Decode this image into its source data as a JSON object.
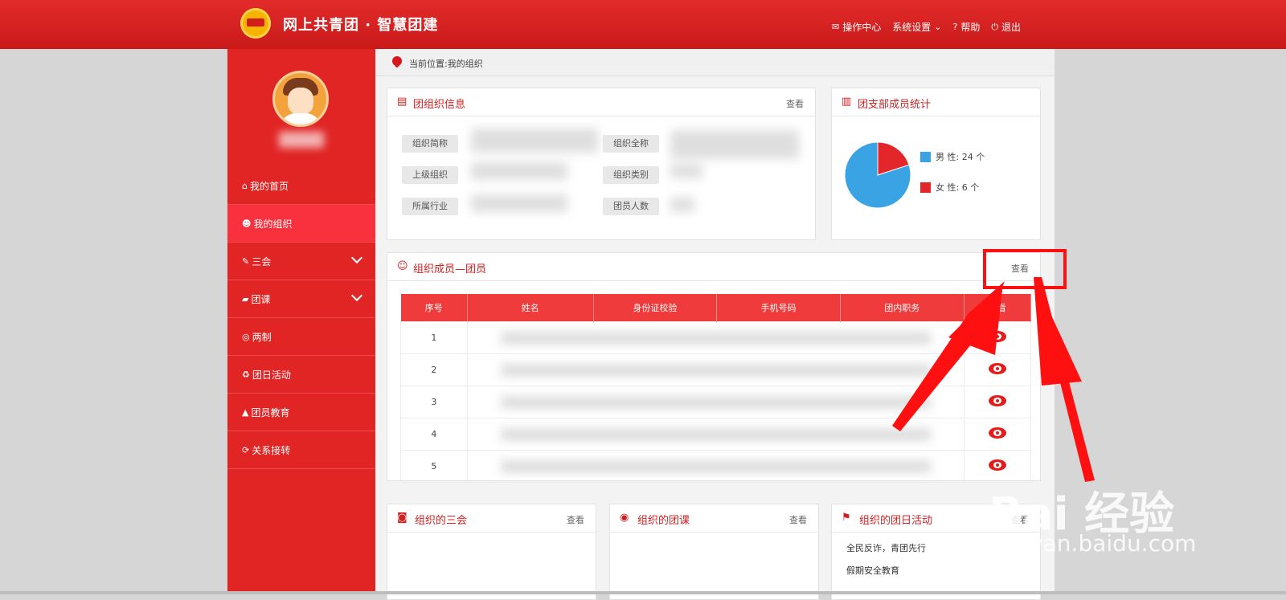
{
  "header": {
    "brand": "网上共青团 · 智慧团建",
    "nav": [
      {
        "icon": "mail-icon",
        "label": "操作中心"
      },
      {
        "icon": "chevron-down-icon",
        "label": "系统设置"
      },
      {
        "icon": "help-icon",
        "label": "帮助"
      },
      {
        "icon": "power-icon",
        "label": "退出"
      }
    ]
  },
  "sidebar": {
    "items": [
      {
        "icon": "home-icon",
        "label": "我的首页"
      },
      {
        "icon": "users-icon",
        "label": "我的组织"
      },
      {
        "icon": "edit-icon",
        "label": "三会"
      },
      {
        "icon": "folder-icon",
        "label": "团课"
      },
      {
        "icon": "target-icon",
        "label": "两制"
      },
      {
        "icon": "recycle-icon",
        "label": "团日活动"
      },
      {
        "icon": "graduation-cap-icon",
        "label": "团员教育"
      },
      {
        "icon": "refresh-icon",
        "label": "关系接转"
      }
    ]
  },
  "breadcrumb": "当前位置:我的组织",
  "org_info": {
    "title": "团组织信息",
    "more": "查看",
    "fields": [
      "组织简称",
      "组织全称",
      "上级组织",
      "组织类别",
      "所属行业",
      "团员人数"
    ]
  },
  "stats": {
    "title": "团支部成员统计",
    "legend": [
      {
        "label": "男 性: 24 个",
        "value": 24,
        "color": "#3aa3e3"
      },
      {
        "label": "女 性: 6 个",
        "value": 6,
        "color": "#e3262a"
      }
    ]
  },
  "members": {
    "title": "组织成员—团员",
    "more": "查看",
    "columns": [
      "序号",
      "姓名",
      "身份证校验",
      "手机号码",
      "团内职务",
      "查看"
    ],
    "rows": [
      "1",
      "2",
      "3",
      "4",
      "5"
    ]
  },
  "bottom_panels": [
    {
      "title": "组织的三会",
      "more": "查看"
    },
    {
      "title": "组织的团课",
      "more": "查看"
    },
    {
      "title": "组织的团日活动",
      "more": "查看",
      "items": [
        "全民反诈，青团先行",
        "假期安全教育"
      ]
    }
  ],
  "watermark": {
    "line1": "Bai 经验",
    "line2": "jingyan.baidu.com"
  },
  "colors": {
    "primary": "#e12525",
    "accent": "#d12020",
    "male": "#3aa3e3",
    "female": "#e3262a"
  }
}
